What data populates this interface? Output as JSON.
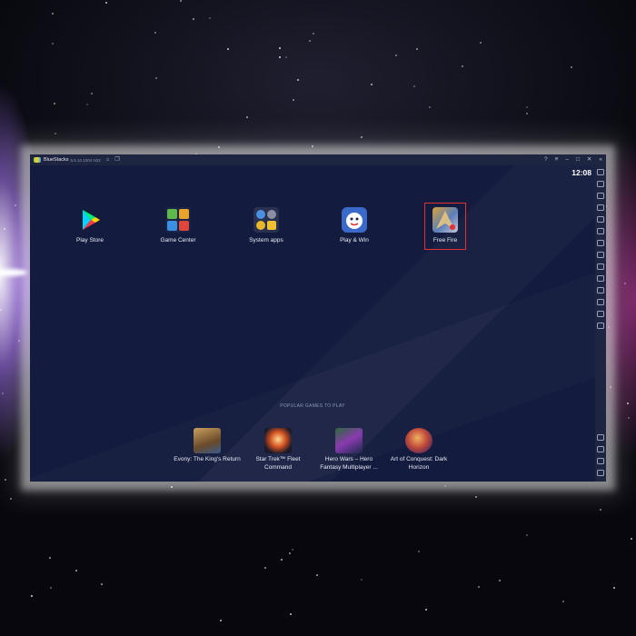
{
  "window": {
    "app_name": "BlueStacks",
    "version": "5.5.10.1004 N32"
  },
  "status": {
    "time": "12:08"
  },
  "home_apps": [
    {
      "label": "Play Store",
      "icon": "play-store-icon"
    },
    {
      "label": "Game Center",
      "icon": "game-center-icon"
    },
    {
      "label": "System apps",
      "icon": "system-apps-icon"
    },
    {
      "label": "Play & Win",
      "icon": "play-and-win-icon"
    },
    {
      "label": "Free Fire",
      "icon": "free-fire-icon",
      "highlighted": true
    }
  ],
  "popular": {
    "heading": "POPULAR GAMES TO PLAY",
    "games": [
      {
        "label": "Evony: The King's Return",
        "icon": "evony-icon"
      },
      {
        "label": "Star Trek™ Fleet Command",
        "icon": "star-trek-icon"
      },
      {
        "label": "Hero Wars – Hero Fantasy Multiplayer ...",
        "icon": "hero-wars-icon"
      },
      {
        "label": "Art of Conquest: Dark Horizon",
        "icon": "art-of-conquest-icon"
      }
    ]
  },
  "colors": {
    "highlight": "#e53030",
    "screen_bg": "#131b3e",
    "chrome": "#1e2540"
  }
}
